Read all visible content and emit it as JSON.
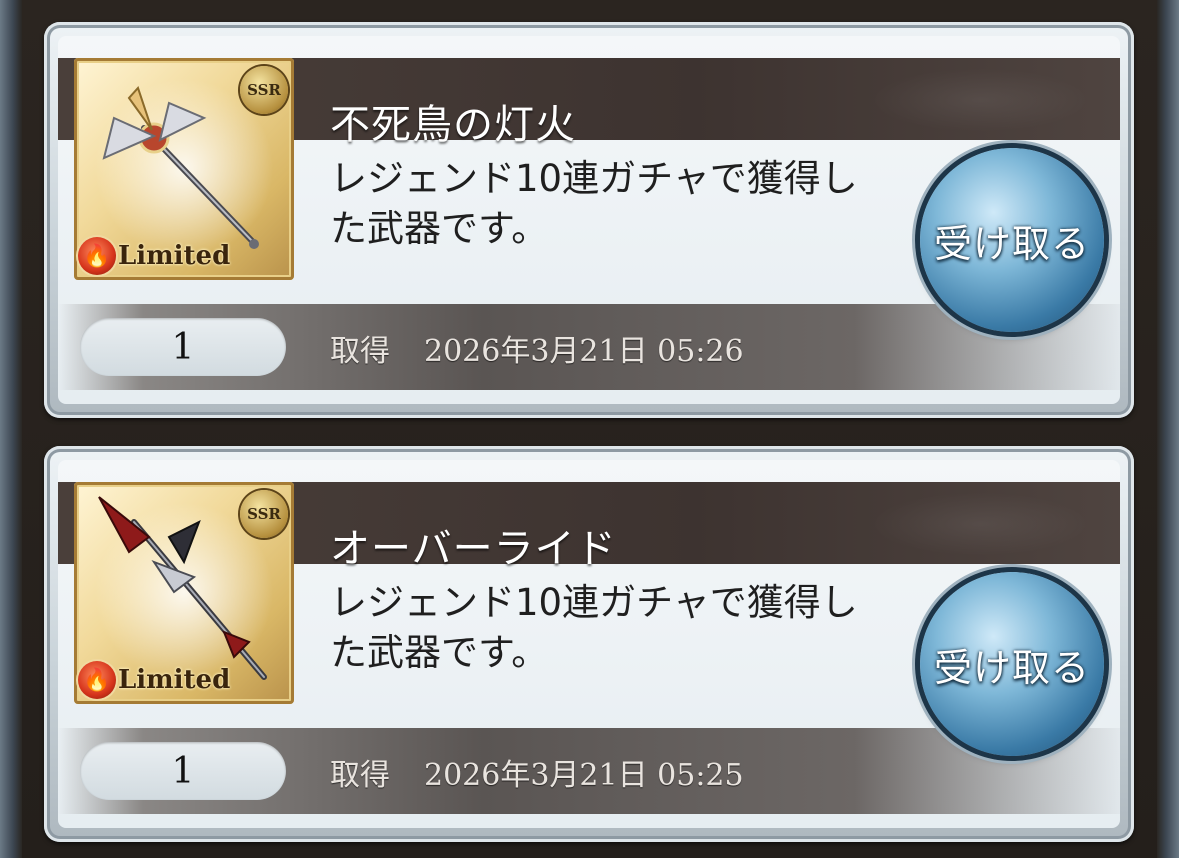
{
  "items": [
    {
      "title": "不死鳥の灯火",
      "description": "レジェンド10連ガチャで獲得した武器です。",
      "rarity": "SSR",
      "badge": "Limited",
      "badge_icon": "fire-icon",
      "quantity": "1",
      "acquired_label": "取得",
      "acquired_date": "2026年3月21日 05:26",
      "button_label": "受け取る",
      "weapon": "staff"
    },
    {
      "title": "オーバーライド",
      "description": "レジェンド10連ガチャで獲得した武器です。",
      "rarity": "SSR",
      "badge": "Limited",
      "badge_icon": "fire-icon",
      "quantity": "1",
      "acquired_label": "取得",
      "acquired_date": "2026年3月21日 05:25",
      "button_label": "受け取る",
      "weapon": "spear"
    }
  ],
  "colors": {
    "title_bar": "#3d3330",
    "button_blue": "#3a7aa6",
    "frame_gold": "#d9b766"
  }
}
